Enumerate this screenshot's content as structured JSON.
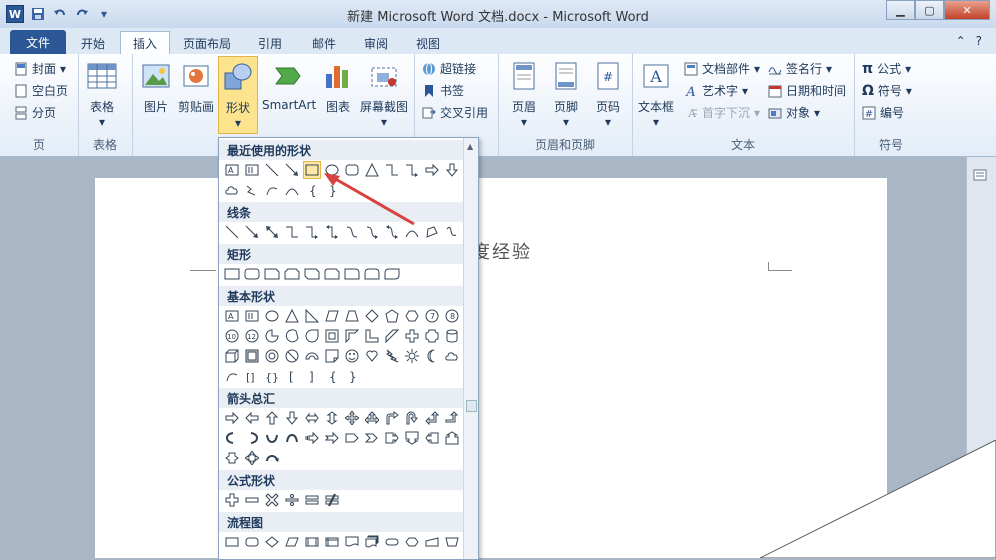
{
  "title_bar": {
    "app_icon": "W",
    "title": "新建 Microsoft Word 文档.docx - Microsoft Word"
  },
  "ribbon_tabs": [
    {
      "label": "文件"
    },
    {
      "label": "开始"
    },
    {
      "label": "插入"
    },
    {
      "label": "页面布局"
    },
    {
      "label": "引用"
    },
    {
      "label": "邮件"
    },
    {
      "label": "审阅"
    },
    {
      "label": "视图"
    }
  ],
  "groups": {
    "pages": {
      "label": "页",
      "items": [
        "封面",
        "空白页",
        "分页"
      ]
    },
    "tables": {
      "label": "表格",
      "button": "表格"
    },
    "illustrations": {
      "picture": "图片",
      "clipart": "剪贴画",
      "shapes": "形状",
      "smartart": "SmartArt",
      "chart": "图表",
      "screenshot": "屏幕截图"
    },
    "links": {
      "hyperlink": "超链接",
      "bookmark": "书签",
      "crossref": "交叉引用"
    },
    "header_footer": {
      "label": "页眉和页脚",
      "header": "页眉",
      "footer": "页脚",
      "page_number": "页码"
    },
    "text": {
      "label": "文本",
      "textbox": "文本框",
      "quick_parts": "文档部件",
      "wordart": "艺术字",
      "dropcap": "首字下沉",
      "signature": "签名行",
      "datetime": "日期和时间",
      "object": "对象"
    },
    "symbols": {
      "label": "符号",
      "equation": "公式",
      "symbol": "符号",
      "number": "编号"
    }
  },
  "shapes_gallery": {
    "sections": [
      {
        "label": "最近使用的形状"
      },
      {
        "label": "线条"
      },
      {
        "label": "矩形"
      },
      {
        "label": "基本形状"
      },
      {
        "label": "箭头总汇"
      },
      {
        "label": "公式形状"
      },
      {
        "label": "流程图"
      }
    ]
  },
  "document": {
    "visible_text": "度经验"
  },
  "colors": {
    "file_tab": "#2b5797",
    "selected_highlight": "#fce38e",
    "annotation_arrow": "#d9423f"
  }
}
